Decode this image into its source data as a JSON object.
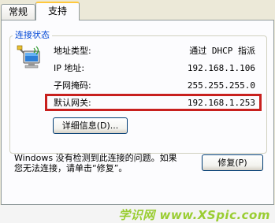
{
  "tabs": [
    {
      "label": "常规"
    },
    {
      "label": "支持"
    }
  ],
  "group": {
    "title": "连接状态",
    "icon": "network-connection-icon"
  },
  "rows": [
    {
      "label": "地址类型:",
      "value": "通过 DHCP 指派"
    },
    {
      "label": "IP 地址:",
      "value": "192.168.1.106"
    },
    {
      "label": "子网掩码:",
      "value": "255.255.255.0"
    },
    {
      "label": "默认网关:",
      "value": "192.168.1.253"
    }
  ],
  "details_button": "详细信息(D)...",
  "message": "Windows 没有检测到此连接的问题。如果\n您无法连接，请单击“修复”。",
  "repair_button": "修复(P)",
  "watermark": "学识网 www.XSpic.com",
  "colors": {
    "highlight": "#c8201e",
    "legend": "#0046d5",
    "watermark": "#9acd32"
  }
}
